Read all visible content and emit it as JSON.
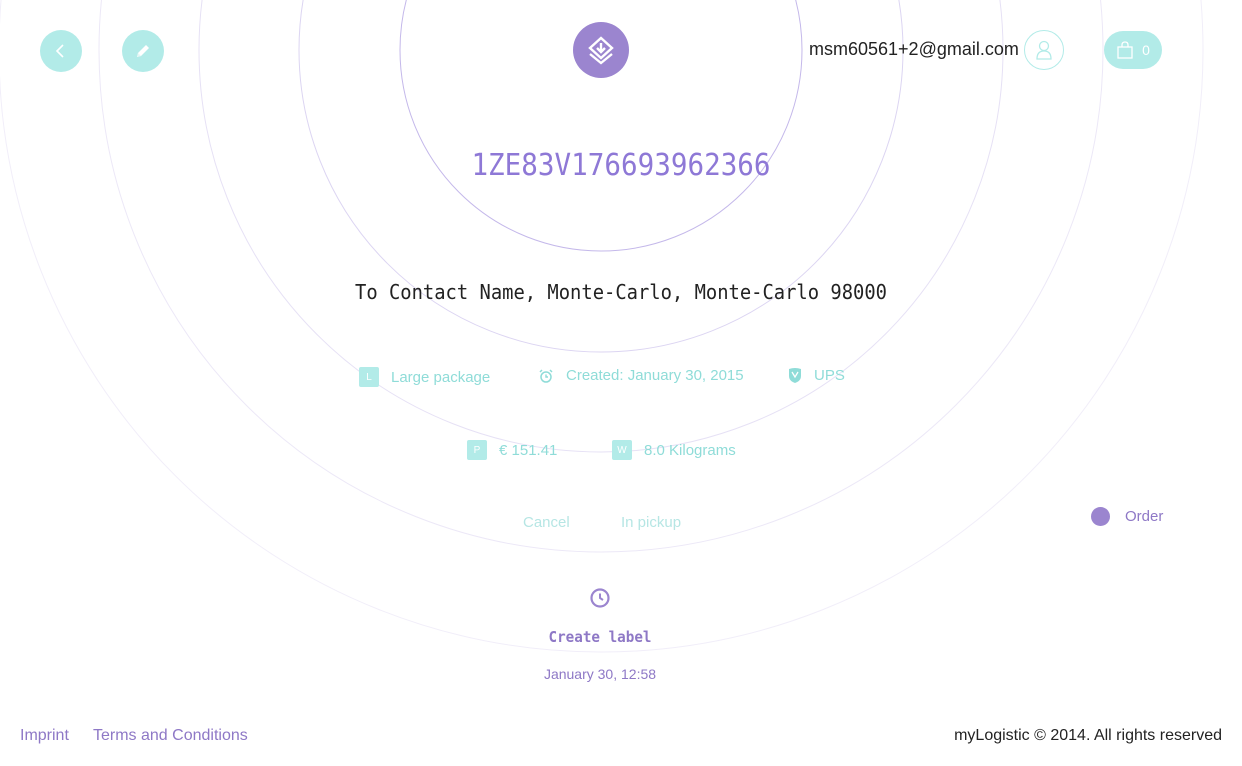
{
  "colors": {
    "accent_teal": "#b2ebe8",
    "accent_purple": "#9b85cf",
    "tracking_purple": "#8e78d6",
    "text_dark": "#222222",
    "meta_teal": "#8fdcd8"
  },
  "header": {
    "back_icon": "chevron-left-icon",
    "edit_icon": "pencil-icon",
    "logo_icon": "layers-download-icon",
    "user_email": "msm60561+2@gmail.com",
    "user_icon": "user-icon",
    "cart_icon": "shopping-bag-icon",
    "cart_count": "0"
  },
  "shipment": {
    "tracking_number": "1ZE83V176693962366",
    "address": "To Contact Name, Monte-Carlo, Monte-Carlo 98000",
    "package_type": {
      "badge": "L",
      "label": "Large package"
    },
    "created": {
      "icon": "alarm-clock-icon",
      "label": "Created: January 30, 2015"
    },
    "carrier": {
      "icon": "ups-shield-icon",
      "label": "UPS"
    },
    "price": {
      "badge": "P",
      "label": "€ 151.41"
    },
    "weight": {
      "badge": "W",
      "label": "8.0 Kilograms"
    }
  },
  "actions": {
    "cancel": "Cancel",
    "in_pickup": "In pickup"
  },
  "legend": {
    "order_label": "Order"
  },
  "timeline": {
    "event_icon": "clock-icon",
    "event_title": "Create label",
    "event_time": "January 30, 12:58"
  },
  "footer": {
    "imprint": "Imprint",
    "terms": "Terms and Conditions",
    "copyright": "myLogistic © 2014. All rights reserved"
  }
}
